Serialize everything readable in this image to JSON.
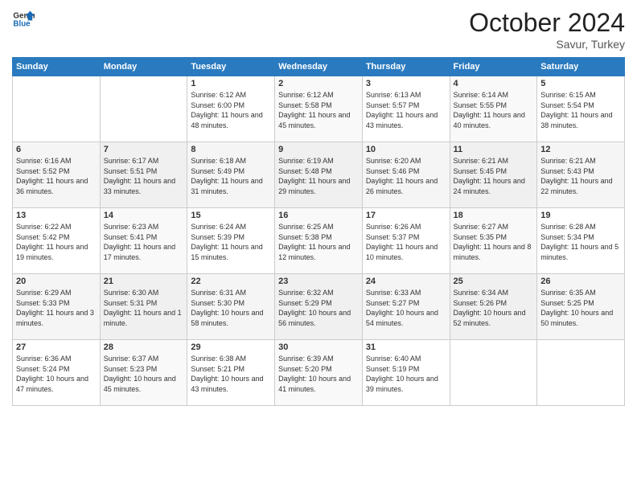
{
  "logo": {
    "line1": "General",
    "line2": "Blue"
  },
  "title": "October 2024",
  "location": "Savur, Turkey",
  "weekdays": [
    "Sunday",
    "Monday",
    "Tuesday",
    "Wednesday",
    "Thursday",
    "Friday",
    "Saturday"
  ],
  "weeks": [
    [
      {
        "day": "",
        "text": ""
      },
      {
        "day": "",
        "text": ""
      },
      {
        "day": "1",
        "text": "Sunrise: 6:12 AM\nSunset: 6:00 PM\nDaylight: 11 hours and 48 minutes."
      },
      {
        "day": "2",
        "text": "Sunrise: 6:12 AM\nSunset: 5:58 PM\nDaylight: 11 hours and 45 minutes."
      },
      {
        "day": "3",
        "text": "Sunrise: 6:13 AM\nSunset: 5:57 PM\nDaylight: 11 hours and 43 minutes."
      },
      {
        "day": "4",
        "text": "Sunrise: 6:14 AM\nSunset: 5:55 PM\nDaylight: 11 hours and 40 minutes."
      },
      {
        "day": "5",
        "text": "Sunrise: 6:15 AM\nSunset: 5:54 PM\nDaylight: 11 hours and 38 minutes."
      }
    ],
    [
      {
        "day": "6",
        "text": "Sunrise: 6:16 AM\nSunset: 5:52 PM\nDaylight: 11 hours and 36 minutes."
      },
      {
        "day": "7",
        "text": "Sunrise: 6:17 AM\nSunset: 5:51 PM\nDaylight: 11 hours and 33 minutes."
      },
      {
        "day": "8",
        "text": "Sunrise: 6:18 AM\nSunset: 5:49 PM\nDaylight: 11 hours and 31 minutes."
      },
      {
        "day": "9",
        "text": "Sunrise: 6:19 AM\nSunset: 5:48 PM\nDaylight: 11 hours and 29 minutes."
      },
      {
        "day": "10",
        "text": "Sunrise: 6:20 AM\nSunset: 5:46 PM\nDaylight: 11 hours and 26 minutes."
      },
      {
        "day": "11",
        "text": "Sunrise: 6:21 AM\nSunset: 5:45 PM\nDaylight: 11 hours and 24 minutes."
      },
      {
        "day": "12",
        "text": "Sunrise: 6:21 AM\nSunset: 5:43 PM\nDaylight: 11 hours and 22 minutes."
      }
    ],
    [
      {
        "day": "13",
        "text": "Sunrise: 6:22 AM\nSunset: 5:42 PM\nDaylight: 11 hours and 19 minutes."
      },
      {
        "day": "14",
        "text": "Sunrise: 6:23 AM\nSunset: 5:41 PM\nDaylight: 11 hours and 17 minutes."
      },
      {
        "day": "15",
        "text": "Sunrise: 6:24 AM\nSunset: 5:39 PM\nDaylight: 11 hours and 15 minutes."
      },
      {
        "day": "16",
        "text": "Sunrise: 6:25 AM\nSunset: 5:38 PM\nDaylight: 11 hours and 12 minutes."
      },
      {
        "day": "17",
        "text": "Sunrise: 6:26 AM\nSunset: 5:37 PM\nDaylight: 11 hours and 10 minutes."
      },
      {
        "day": "18",
        "text": "Sunrise: 6:27 AM\nSunset: 5:35 PM\nDaylight: 11 hours and 8 minutes."
      },
      {
        "day": "19",
        "text": "Sunrise: 6:28 AM\nSunset: 5:34 PM\nDaylight: 11 hours and 5 minutes."
      }
    ],
    [
      {
        "day": "20",
        "text": "Sunrise: 6:29 AM\nSunset: 5:33 PM\nDaylight: 11 hours and 3 minutes."
      },
      {
        "day": "21",
        "text": "Sunrise: 6:30 AM\nSunset: 5:31 PM\nDaylight: 11 hours and 1 minute."
      },
      {
        "day": "22",
        "text": "Sunrise: 6:31 AM\nSunset: 5:30 PM\nDaylight: 10 hours and 58 minutes."
      },
      {
        "day": "23",
        "text": "Sunrise: 6:32 AM\nSunset: 5:29 PM\nDaylight: 10 hours and 56 minutes."
      },
      {
        "day": "24",
        "text": "Sunrise: 6:33 AM\nSunset: 5:27 PM\nDaylight: 10 hours and 54 minutes."
      },
      {
        "day": "25",
        "text": "Sunrise: 6:34 AM\nSunset: 5:26 PM\nDaylight: 10 hours and 52 minutes."
      },
      {
        "day": "26",
        "text": "Sunrise: 6:35 AM\nSunset: 5:25 PM\nDaylight: 10 hours and 50 minutes."
      }
    ],
    [
      {
        "day": "27",
        "text": "Sunrise: 6:36 AM\nSunset: 5:24 PM\nDaylight: 10 hours and 47 minutes."
      },
      {
        "day": "28",
        "text": "Sunrise: 6:37 AM\nSunset: 5:23 PM\nDaylight: 10 hours and 45 minutes."
      },
      {
        "day": "29",
        "text": "Sunrise: 6:38 AM\nSunset: 5:21 PM\nDaylight: 10 hours and 43 minutes."
      },
      {
        "day": "30",
        "text": "Sunrise: 6:39 AM\nSunset: 5:20 PM\nDaylight: 10 hours and 41 minutes."
      },
      {
        "day": "31",
        "text": "Sunrise: 6:40 AM\nSunset: 5:19 PM\nDaylight: 10 hours and 39 minutes."
      },
      {
        "day": "",
        "text": ""
      },
      {
        "day": "",
        "text": ""
      }
    ]
  ]
}
